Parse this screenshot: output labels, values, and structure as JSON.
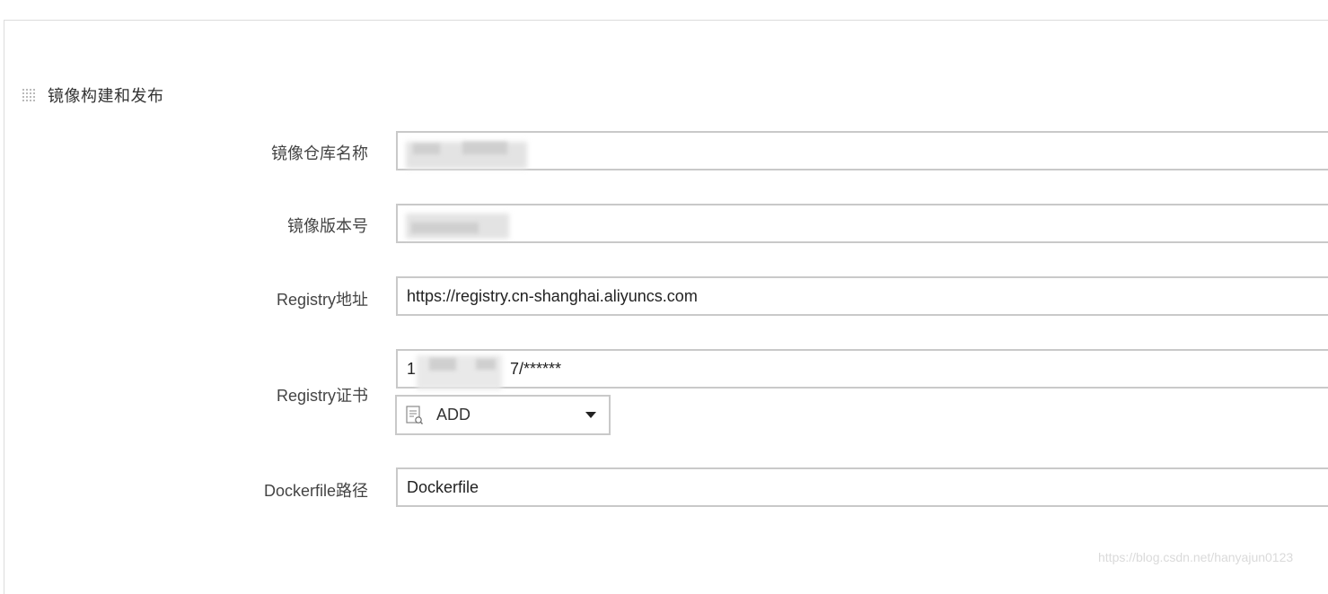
{
  "section": {
    "title": "镜像构建和发布"
  },
  "fields": {
    "repo_name": {
      "label": "镜像仓库名称",
      "value": ""
    },
    "image_version": {
      "label": "镜像版本号",
      "value": ""
    },
    "registry_url": {
      "label": "Registry地址",
      "value": "https://registry.cn-shanghai.aliyuncs.com"
    },
    "registry_cert": {
      "label": "Registry证书",
      "value_prefix": "1",
      "value_suffix": "7/******"
    },
    "dockerfile_path": {
      "label": "Dockerfile路径",
      "value": "Dockerfile"
    }
  },
  "add_dropdown": {
    "label": "ADD"
  },
  "watermark": "https://blog.csdn.net/hanyajun0123",
  "colors": {
    "border": "#c9c9c9",
    "text": "#333333",
    "watermark": "#dadada"
  }
}
